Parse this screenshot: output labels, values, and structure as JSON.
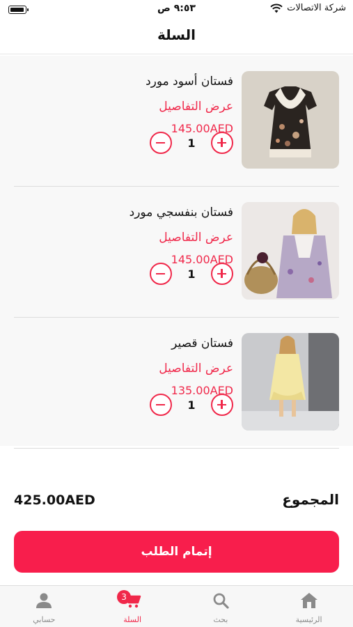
{
  "status_bar": {
    "time": "٩:٥٣ ص",
    "carrier": "شركة الاتصالات"
  },
  "header": {
    "title": "السلة"
  },
  "cart": {
    "items": [
      {
        "name": "فستان أسود مورد",
        "details_link": "عرض التفاصيل",
        "price": "145.00AED",
        "quantity": "1"
      },
      {
        "name": "فستان بنفسجي مورد",
        "details_link": "عرض التفاصيل",
        "price": "145.00AED",
        "quantity": "1"
      },
      {
        "name": "فستان قصير",
        "details_link": "عرض التفاصيل",
        "price": "135.00AED",
        "quantity": "1"
      }
    ]
  },
  "summary": {
    "total_label": "المجموع",
    "total_value": "425.00AED"
  },
  "checkout": {
    "label": "إتمام الطلب"
  },
  "tab_bar": {
    "tabs": [
      {
        "label": "الرئيسية",
        "icon": "home-icon"
      },
      {
        "label": "بحث",
        "icon": "search-icon"
      },
      {
        "label": "السلة",
        "icon": "cart-icon",
        "badge": "3"
      },
      {
        "label": "حسابي",
        "icon": "user-icon"
      }
    ],
    "active_tab": "السلة"
  },
  "colors": {
    "accent": "#f0284a",
    "checkout_button": "#f81e4c",
    "tab_inactive": "#8a8a8a"
  }
}
